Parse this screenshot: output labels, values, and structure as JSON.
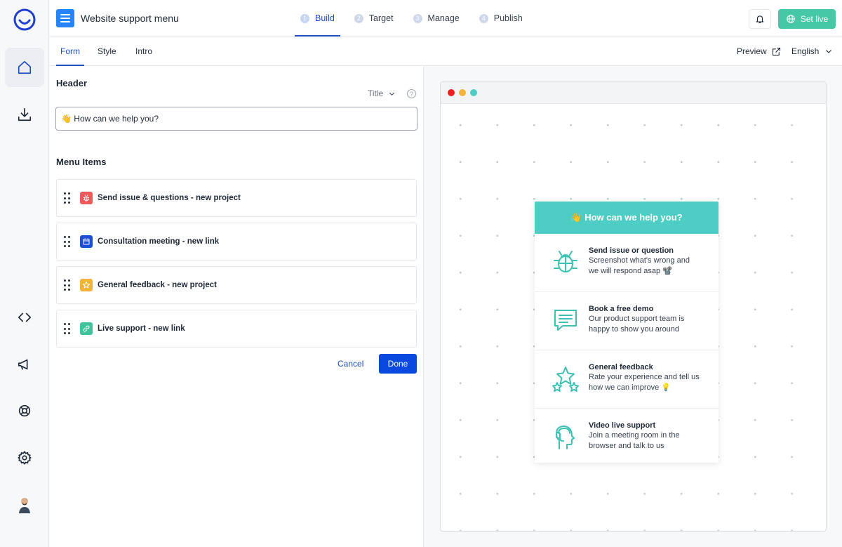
{
  "app": {
    "title": "Website support menu"
  },
  "steps": [
    {
      "num": "1",
      "label": "Build"
    },
    {
      "num": "2",
      "label": "Target"
    },
    {
      "num": "3",
      "label": "Manage"
    },
    {
      "num": "4",
      "label": "Publish"
    }
  ],
  "actions": {
    "set_live": "Set live",
    "preview": "Preview",
    "language": "English"
  },
  "subtabs": [
    "Form",
    "Style",
    "Intro"
  ],
  "form": {
    "header_label": "Header",
    "title_type": "Title",
    "help_glyph": "?",
    "header_value": "👋 How can we help you?",
    "menu_items_label": "Menu Items",
    "menu_items": [
      "Send issue & questions - new project",
      "Consultation meeting - new link",
      "General feedback - new project",
      "Live support - new link"
    ],
    "cancel": "Cancel",
    "done": "Done"
  },
  "widget": {
    "title": "👋 How can we help you?",
    "rows": [
      {
        "title": "Send issue or question",
        "desc": "Screenshot what's wrong and we will respond asap 📽️"
      },
      {
        "title": "Book a free demo",
        "desc": "Our product support team is happy to show you around"
      },
      {
        "title": "General feedback",
        "desc": "Rate your experience and tell us how we can improve 💡"
      },
      {
        "title": "Video live support",
        "desc": "Join a meeting room in the browser and talk to us"
      }
    ]
  },
  "colors": {
    "primary": "#0a49e0",
    "active_tab": "#1e4fbf",
    "set_live": "#46c8a6",
    "widget_header": "#4ecdc4",
    "icon_issue": "#ef5b5b",
    "icon_meeting": "#1d4ed8",
    "icon_feedback": "#f6b33a",
    "icon_live": "#3fc39a"
  },
  "icons": {
    "rail": [
      "home-icon",
      "download-icon",
      "code-icon",
      "megaphone-icon",
      "lifebuoy-icon",
      "settings-icon",
      "avatar"
    ],
    "menu_items": [
      "bug-icon",
      "calendar-icon",
      "star-icon",
      "link-icon"
    ],
    "widget_rows": [
      "bug-icon",
      "chat-icon",
      "stars-icon",
      "head-headset-icon"
    ]
  }
}
